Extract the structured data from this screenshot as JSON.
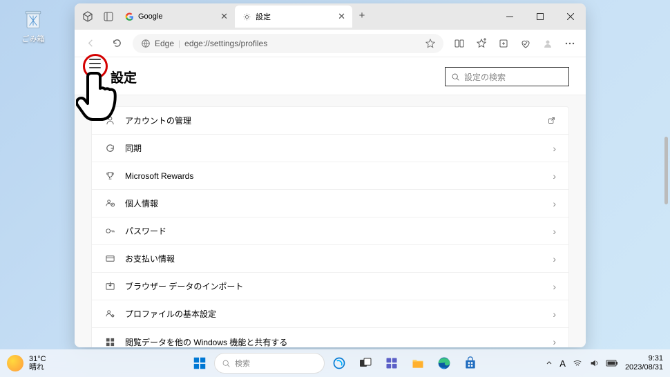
{
  "desktop": {
    "recycle_bin": "ごみ箱"
  },
  "window": {
    "tabs": [
      {
        "label": "Google"
      },
      {
        "label": "設定"
      }
    ],
    "address": {
      "scheme": "Edge",
      "url": "edge://settings/profiles"
    },
    "win_min": "─",
    "win_max": "☐",
    "win_close": "✕"
  },
  "page": {
    "title": "設定",
    "search_placeholder": "設定の検索",
    "rows": [
      {
        "label": "アカウントの管理",
        "icon": "person-icon",
        "trail": "external"
      },
      {
        "label": "同期",
        "icon": "sync-icon",
        "trail": "chevron"
      },
      {
        "label": "Microsoft Rewards",
        "icon": "trophy-icon",
        "trail": "chevron"
      },
      {
        "label": "個人情報",
        "icon": "profile-icon",
        "trail": "chevron"
      },
      {
        "label": "パスワード",
        "icon": "key-icon",
        "trail": "chevron"
      },
      {
        "label": "お支払い情報",
        "icon": "card-icon",
        "trail": "chevron"
      },
      {
        "label": "ブラウザー データのインポート",
        "icon": "import-icon",
        "trail": "chevron"
      },
      {
        "label": "プロファイルの基本設定",
        "icon": "gear-icon",
        "trail": "chevron"
      },
      {
        "label": "閲覧データを他の Windows 機能と共有する",
        "icon": "windows-icon",
        "trail": "chevron"
      }
    ]
  },
  "taskbar": {
    "weather_temp": "31°C",
    "weather_cond": "晴れ",
    "search_placeholder": "検索",
    "ime": "A",
    "time": "9:31",
    "date": "2023/08/31"
  }
}
